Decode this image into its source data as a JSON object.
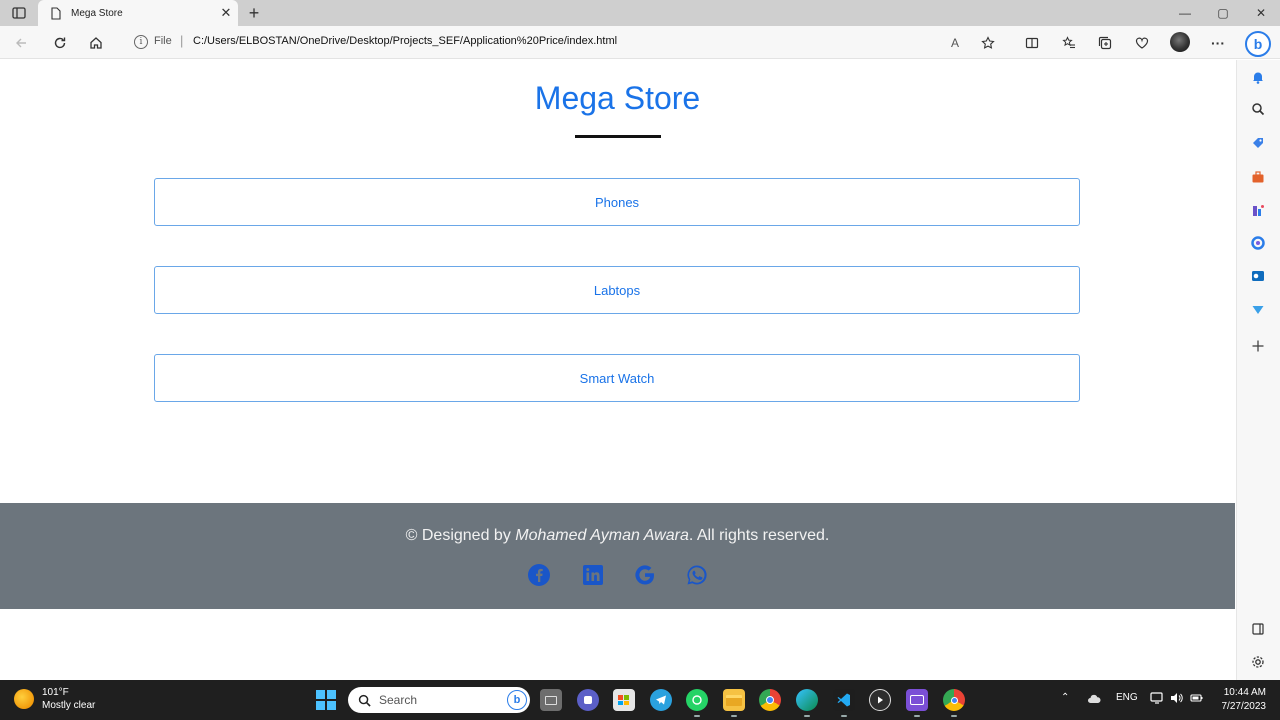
{
  "browser": {
    "tab_title": "Mega Store",
    "close_glyph": "✕",
    "new_tab_glyph": "+",
    "window_controls": {
      "minimize": "—",
      "maximize": "▢",
      "close": "✕"
    },
    "address": {
      "scheme_label": "File",
      "separator": "|",
      "url": "C:/Users/ELBOSTAN/OneDrive/Desktop/Projects_SEF/Application%20Price/index.html"
    },
    "toolbar_icons": {
      "read_aloud": "A",
      "more": "···"
    },
    "bing_label": "b"
  },
  "page": {
    "title": "Mega Store",
    "categories": [
      {
        "label": "Phones"
      },
      {
        "label": "Labtops"
      },
      {
        "label": "Smart Watch"
      }
    ],
    "footer": {
      "prefix": "© Designed by ",
      "author": "Mohamed Ayman Awara",
      "suffix": ". All rights reserved.",
      "social_icons": [
        "facebook-icon",
        "linkedin-icon",
        "google-icon",
        "whatsapp-icon"
      ],
      "social_icon_color": "#1a56c8"
    }
  },
  "taskbar": {
    "weather": {
      "temp": "101°F",
      "condition": "Mostly clear"
    },
    "search_placeholder": "Search",
    "search_bing": "b",
    "tray": {
      "language": "ENG",
      "up_arrow": "⌃"
    },
    "clock": {
      "time": "10:44 AM",
      "date": "7/27/2023"
    }
  },
  "colors": {
    "accent": "#1a73e8",
    "footer_bg": "#6c757d",
    "taskbar_bg": "#1f1f1f"
  }
}
